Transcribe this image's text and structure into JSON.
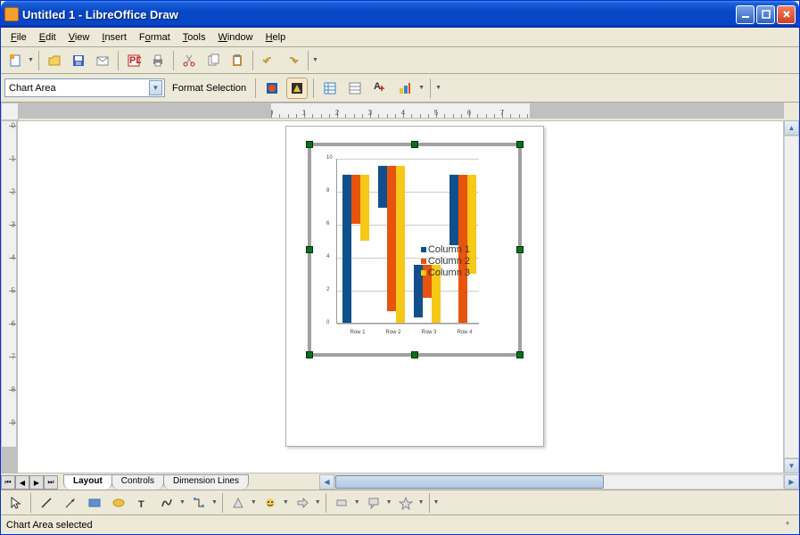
{
  "window": {
    "title": "Untitled 1 - LibreOffice Draw"
  },
  "menu": {
    "items": [
      "File",
      "Edit",
      "View",
      "Insert",
      "Format",
      "Tools",
      "Window",
      "Help"
    ]
  },
  "format_bar": {
    "combo_value": "Chart Area",
    "format_selection": "Format Selection"
  },
  "tabs": {
    "items": [
      "Layout",
      "Controls",
      "Dimension Lines"
    ],
    "active": 0
  },
  "status": {
    "text": "Chart Area selected",
    "modified": "*"
  },
  "colors": {
    "series1": "#104f8c",
    "series2": "#e8530e",
    "series3": "#f6c817",
    "grid": "#cccccc"
  },
  "chart_data": {
    "type": "bar",
    "categories": [
      "Row 1",
      "Row 2",
      "Row 3",
      "Row 4"
    ],
    "series": [
      {
        "name": "Column 1",
        "values": [
          9.0,
          2.5,
          3.2,
          4.3
        ]
      },
      {
        "name": "Column 2",
        "values": [
          3.0,
          8.8,
          2.0,
          9.0
        ]
      },
      {
        "name": "Column 3",
        "values": [
          4.0,
          9.5,
          3.5,
          6.0
        ]
      }
    ],
    "ylim": [
      0,
      10
    ],
    "yticks": [
      0,
      2,
      4,
      6,
      8,
      10
    ],
    "xlabel": "",
    "ylabel": "",
    "title": ""
  }
}
